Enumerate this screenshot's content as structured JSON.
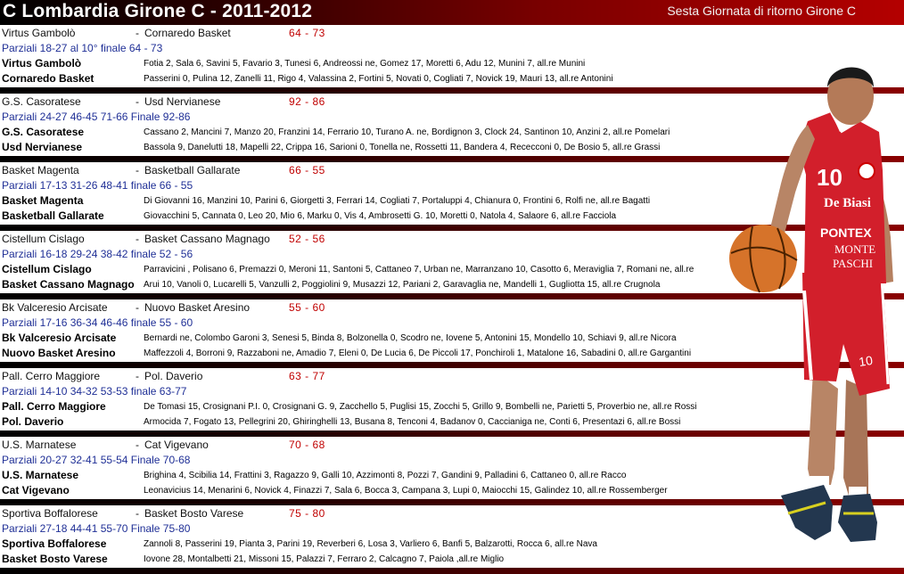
{
  "header": {
    "title": "C Lombardia Girone C - 2011-2012",
    "subtitle": "Sesta Giornata di ritorno Girone C"
  },
  "games": [
    {
      "home": "Virtus Gambolò",
      "away": "Cornaredo Basket",
      "dash": "-",
      "score": "64  -  73",
      "parziali": "Parziali 18-27 al 10° finale 64 - 73",
      "rosters": [
        {
          "team": "Virtus Gambolò",
          "players": "Fotia 2, Sala 6, Savini 5, Favario 3, Tunesi 6, Andreossi ne, Gomez 17, Moretti 6, Adu 12, Munini 7, all.re Munini"
        },
        {
          "team": "Cornaredo Basket",
          "players": "Passerini 0, Pulina 12, Zanelli 11, Rigo 4, Valassina 2, Fortini 5, Novati 0, Cogliati 7, Novick 19, Mauri 13, all.re Antonini"
        }
      ]
    },
    {
      "home": "G.S. Casoratese",
      "away": "Usd Nervianese",
      "dash": "-",
      "score": "92  -  86",
      "parziali": "Parziali 24-27  46-45  71-66  Finale 92-86",
      "rosters": [
        {
          "team": "G.S. Casoratese",
          "players": "Cassano 2, Mancini 7, Manzo 20, Franzini 14, Ferrario 10, Turano A. ne, Bordignon 3, Clock 24, Santinon 10, Anzini 2, all.re Pomelari"
        },
        {
          "team": "Usd Nervianese",
          "players": "Bassola 9, Danelutti 18, Mapelli 22, Crippa 16, Sarioni 0, Tonella ne, Rossetti 11, Bandera 4, Rececconi 0, De Bosio 5, all.re Grassi"
        }
      ]
    },
    {
      "home": "Basket Magenta",
      "away": "Basketball Gallarate",
      "dash": "-",
      "score": "66  -  55",
      "parziali": "Parziali 17-13 31-26 48-41 finale 66 - 55",
      "rosters": [
        {
          "team": "Basket Magenta",
          "players": "Di Giovanni 16, Manzini 10, Parini 6, Giorgetti 3, Ferrari 14, Cogliati 7, Portaluppi 4, Chianura 0, Frontini 6, Rolfi ne, all.re Bagatti"
        },
        {
          "team": "Basketball Gallarate",
          "players": "Giovacchini 5, Cannata 0, Leo 20, Mio 6, Marku 0, Vis 4, Ambrosetti G. 10, Moretti 0, Natola 4, Salaore 6, all.re Facciola"
        }
      ]
    },
    {
      "home": "Cistellum Cislago",
      "away": "Basket Cassano Magnago",
      "dash": "-",
      "score": "52  -  56",
      "parziali": "Parziali 16-18 29-24 38-42 finale 52 - 56",
      "rosters": [
        {
          "team": "Cistellum Cislago",
          "players": "Parravicini , Polisano 6, Premazzi 0, Meroni 11, Santoni 5, Cattaneo 7, Urban ne, Marranzano 10, Casotto 6, Meraviglia 7, Romani ne, all.re"
        },
        {
          "team": "Basket Cassano Magnago",
          "players": "Arui 10, Vanoli 0, Lucarelli 5, Vanzulli 2, Poggiolini 9, Musazzi 12, Pariani 2, Garavaglia ne, Mandelli 1, Gugliotta 15, all.re Crugnola"
        }
      ]
    },
    {
      "home": "Bk Valceresio Arcisate",
      "away": "Nuovo Basket Aresino",
      "dash": "-",
      "score": "55  -  60",
      "parziali": "Parziali 17-16 36-34 46-46 finale 55 - 60",
      "rosters": [
        {
          "team": "Bk Valceresio Arcisate",
          "players": "Bernardi ne, Colombo Garoni 3, Senesi 5, Binda 8, Bolzonella 0, Scodro ne, Iovene 5, Antonini 15, Mondello 10, Schiavi 9, all.re Nicora"
        },
        {
          "team": "Nuovo Basket Aresino",
          "players": "Maffezzoli 4, Borroni 9, Razzaboni ne, Amadio 7, Eleni 0, De Lucia 6, De Piccoli 17, Ponchiroli 1, Matalone 16, Sabadini 0, all.re Gargantini"
        }
      ]
    },
    {
      "home": "Pall. Cerro Maggiore",
      "away": "Pol. Daverio",
      "dash": "-",
      "score": "63  -  77",
      "parziali": "Parziali 14-10 34-32 53-53 finale 63-77",
      "rosters": [
        {
          "team": "Pall. Cerro Maggiore",
          "players": "De Tomasi 15, Crosignani P.I. 0, Crosignani G. 9, Zacchello 5, Puglisi 15, Zocchi 5, Grillo 9, Bombelli ne, Parietti 5, Proverbio ne, all.re Rossi"
        },
        {
          "team": "Pol. Daverio",
          "players": "Armocida 7, Fogato 13, Pellegrini 20, Ghiringhelli 13, Busana 8, Tenconi 4, Badanov 0, Caccianiga ne, Conti 6, Presentazi 6, all.re Bossi"
        }
      ]
    },
    {
      "home": "U.S. Marnatese",
      "away": "Cat Vigevano",
      "dash": "-",
      "score": "70  -  68",
      "parziali": "Parziali  20-27  32-41  55-54  Finale 70-68",
      "rosters": [
        {
          "team": "U.S. Marnatese",
          "players": "Brighina 4, Scibilia 14, Frattini 3, Ragazzo 9, Galli 10, Azzimonti 8, Pozzi 7, Gandini 9, Palladini 6, Cattaneo 0, all.re Racco"
        },
        {
          "team": "Cat Vigevano",
          "players": "Leonavicius 14, Menarini 6, Novick 4, Finazzi 7, Sala 6, Bocca 3, Campana 3, Lupi 0, Maiocchi 15, Galindez 10, all.re Rossemberger"
        }
      ]
    },
    {
      "home": "Sportiva Boffalorese",
      "away": "Basket Bosto Varese",
      "dash": "-",
      "score": "75  -  80",
      "parziali": "Parziali  27-18  44-41  55-70  Finale 75-80",
      "rosters": [
        {
          "team": "Sportiva Boffalorese",
          "players": "Zannoli 8, Passerini 19, Pianta 3, Parini 19, Reverberi 6, Losa 3, Varliero 6, Banfi 5, Balzarotti, Rocca 6, all.re Nava"
        },
        {
          "team": "Basket Bosto Varese",
          "players": "Iovone 28, Montalbetti 21, Missoni 15, Palazzi 7, Ferraro 2, Calcagno 7, Paiola ,all.re Miglio"
        }
      ]
    }
  ],
  "player_jersey": {
    "number": "10",
    "sponsor1": "De Biasi",
    "sponsor2": "PONTEX",
    "sponsor3": "MONTE",
    "sponsor4": "PASCHI",
    "shorts_number": "10"
  },
  "colors": {
    "header_dark": "#000000",
    "header_red": "#b40000",
    "score_red": "#c00000",
    "parziali_blue": "#1f2f96",
    "jersey_red": "#d21f2b"
  }
}
